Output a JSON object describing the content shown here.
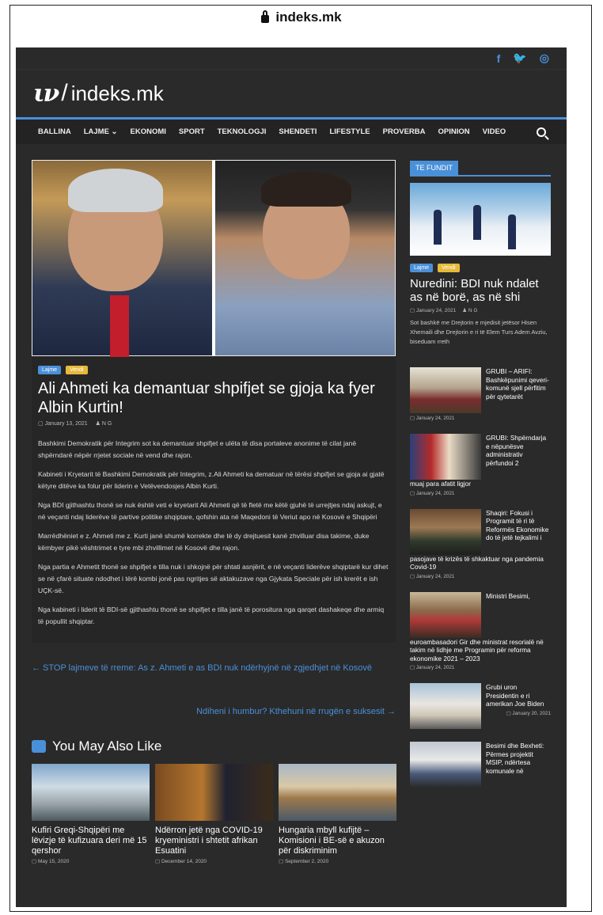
{
  "browser": {
    "url": "indeks.mk"
  },
  "header": {
    "social": [
      "f",
      "twitter",
      "instagram"
    ],
    "logo_mark": "ιν",
    "logo_text": "indeks.mk"
  },
  "nav": {
    "items": [
      "BALLINA",
      "LAJME ⌄",
      "EKONOMI",
      "SPORT",
      "TEKNOLOGJI",
      "SHENDETI",
      "LIFESTYLE",
      "PROVERBA",
      "OPINION",
      "VIDEO"
    ]
  },
  "article": {
    "tags": [
      "Lajme",
      "Vendi"
    ],
    "title": "Ali Ahmeti ka demantuar shpifjet se gjoja ka fyer Albin Kurtin!",
    "date": "January 13, 2021",
    "author": "N G",
    "paragraphs": [
      "Bashkimi Demokratik për Integrim sot ka demantuar shpifjet e ulëta të disa portaleve anonime të cilat janë shpërndarë nëpër rrjetet sociale në vend dhe rajon.",
      "Kabineti i Kryetarit të Bashkimi Demokratik për Integrim, z.Ali Ahmeti ka dematuar në tërësi shpifjet se gjoja ai gjatë këtyre ditëve ka folur për liderin e Vetëvendosjes Albin Kurti.",
      "Nga BDI gjithashtu thonë se nuk është veti e kryetarit Ali Ahmeti që të fletë me këtë gjuhë të urrejtjes ndaj askujt, e në veçanti ndaj liderëve të partive politike shqiptare, qofshin ata në Maqedoni të Veriut apo në Kosovë e Shqipëri",
      "Marrëdhëniet e z. Ahmeti me z. Kurti janë shumë korrekte dhe të dy drejtuesit kanë zhvilluar disa takime, duke këmbyer pikë vështrimet e tyre mbi zhvillimet në Kosovë dhe rajon.",
      "Nga partia e Ahmetit thonë se shpifjet e tilla nuk i shkojnë për shtati asnjërit, e në veçanti liderëve shqiptarë kur dihet se në çfarë situate ndodhet i tërë kombi jonë pas ngritjes së aktakuzave nga Gjykata Speciale për ish krerët e ish UÇK-së.",
      "Nga kabineti i liderit të BDI-së gjithashtu thonë se shpifjet e tilla janë të porositura nga qarqet dashakeqe dhe armiq të popullit shqiptar."
    ],
    "prev_link": "← STOP lajmeve të rreme: As z. Ahmeti e as BDI nuk ndërhyjnë në zgjedhjet në Kosovë",
    "next_link": "Ndiheni i humbur? Kthehuni në rrugën e suksesit →"
  },
  "also": {
    "heading": "You May Also Like",
    "cards": [
      {
        "title": "Kufiri Greqi-Shqipëri me lëvizje të kufizuara deri më 15 qershor",
        "date": "May 15, 2020"
      },
      {
        "title": "Ndërron jetë nga COVID-19 kryeministri i shtetit afrikan Esuatini",
        "date": "December 14, 2020"
      },
      {
        "title": "Hungaria mbyll kufijtë – Komisioni i BE-së e akuzon për diskriminim",
        "date": "September 2, 2020"
      }
    ]
  },
  "sidebar": {
    "heading": "TE FUNDIT",
    "featured": {
      "tags": [
        "Lajme",
        "Vendi"
      ],
      "title": "Nuredini: BDI nuk ndalet as në borë, as në shi",
      "date": "January 24, 2021",
      "author": "N G",
      "excerpt": "Sot bashkë me Drejtorin e mjedisit jetësor Hisen Xhemaili dhe Drejtorin e ri të Elem Turs Adem Avziu, biseduam rreth"
    },
    "news": [
      {
        "title": "GRUBI – ARIFI: Bashkëpunimi qeveri-komunë sjell përfitim për qytetarët",
        "cont": "",
        "date": "January 24, 2021"
      },
      {
        "title": "GRUBI: Shpërndarja e nëpunësve administrativ përfundoi 2",
        "cont": "muaj para afatit ligjor",
        "date": "January 24, 2021"
      },
      {
        "title": "Shaqiri: Fokusi i Programit të ri të Reformës Ekonomike do të jetë tejkalimi i",
        "cont": "pasojave të krizës të shkaktuar nga pandemia Covid-19",
        "date": "January 24, 2021"
      },
      {
        "title": "Ministri Besimi,",
        "cont": "euroambasadori Gir dhe ministrat resorialë në takim në lidhje me Programin për reforma ekonomike 2021 – 2023",
        "date": "January 24, 2021"
      },
      {
        "title": "Grubi uron Presidentin e ri amerikan Joe Biden",
        "cont": "",
        "date": "January 20, 2021"
      },
      {
        "title": "Besimi dhe Bexheti: Përmes projektit MSIP, ndërtesa komunale në",
        "cont": "",
        "date": ""
      }
    ]
  }
}
